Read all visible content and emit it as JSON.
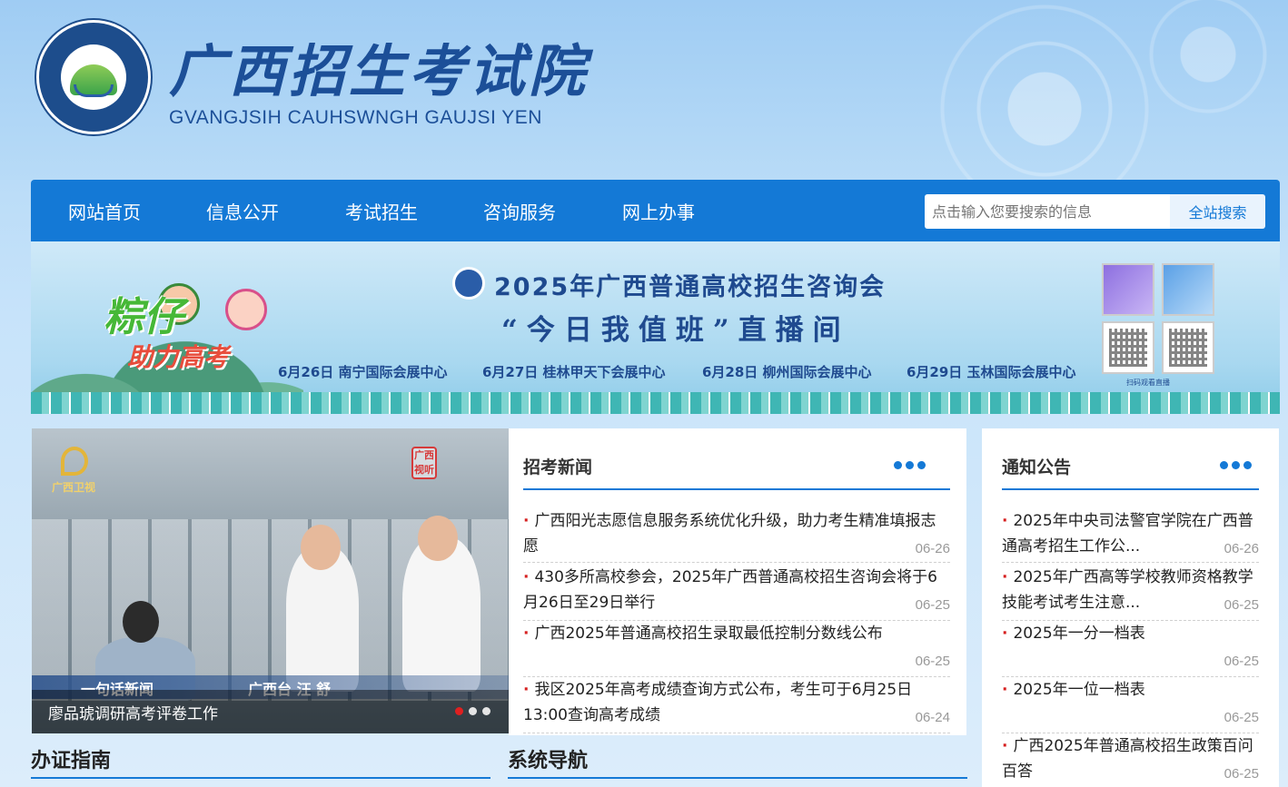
{
  "header": {
    "title_cn": "广西招生考试院",
    "title_en": "GVANGJSIH CAUHSWNGH GAUJSI YEN",
    "seal_text": "广西招生考试院 GVANGJSIH CAUHSWNGH GAUJSI YEN"
  },
  "nav": {
    "items": [
      "网站首页",
      "信息公开",
      "考试招生",
      "咨询服务",
      "网上办事"
    ],
    "search_placeholder": "点击输入您要搜索的信息",
    "search_button": "全站搜索"
  },
  "banner": {
    "slogan_1": "粽仔",
    "slogan_2": "助力高考",
    "title": "2025年广西普通高校招生咨询会",
    "subtitle": "“今日我值班”直播间",
    "schedule": [
      "6月26日 南宁国际会展中心",
      "6月27日 桂林甲天下会展中心",
      "6月28日 柳州国际会展中心",
      "6月29日 玉林国际会展中心"
    ],
    "qr_caption": "扫码观看直播"
  },
  "photo": {
    "tv_name": "广西卫视",
    "tv_badge": "广西视听",
    "tag_left": "一句话新闻",
    "tag_right": "广西台 汪 舒",
    "caption": "廖品琥调研高考评卷工作"
  },
  "news": {
    "title": "招考新闻",
    "items": [
      {
        "text": "广西阳光志愿信息服务系统优化升级，助力考生精准填报志愿",
        "date": "06-26"
      },
      {
        "text": "430多所高校参会，2025年广西普通高校招生咨询会将于6月26日至29日举行",
        "date": "06-25"
      },
      {
        "text": "广西2025年普通高校招生录取最低控制分数线公布",
        "date": "06-25"
      },
      {
        "text": "我区2025年高考成绩查询方式公布，考生可于6月25日13:00查询高考成绩",
        "date": "06-24"
      }
    ]
  },
  "notices": {
    "title": "通知公告",
    "items": [
      {
        "text": "2025年中央司法警官学院在广西普通高考招生工作公...",
        "date": "06-26"
      },
      {
        "text": "2025年广西高等学校教师资格教学技能考试考生注意...",
        "date": "06-25"
      },
      {
        "text": "2025年一分一档表",
        "date": "06-25"
      },
      {
        "text": "2025年一位一档表",
        "date": "06-25"
      },
      {
        "text": "广西2025年普通高校招生政策百问百答",
        "date": "06-25"
      }
    ]
  },
  "sections": {
    "guide": "办证指南",
    "system_nav": "系统导航"
  },
  "colors": {
    "primary": "#1479d6",
    "title_blue": "#1c4f98",
    "bullet_red": "#d62020"
  }
}
